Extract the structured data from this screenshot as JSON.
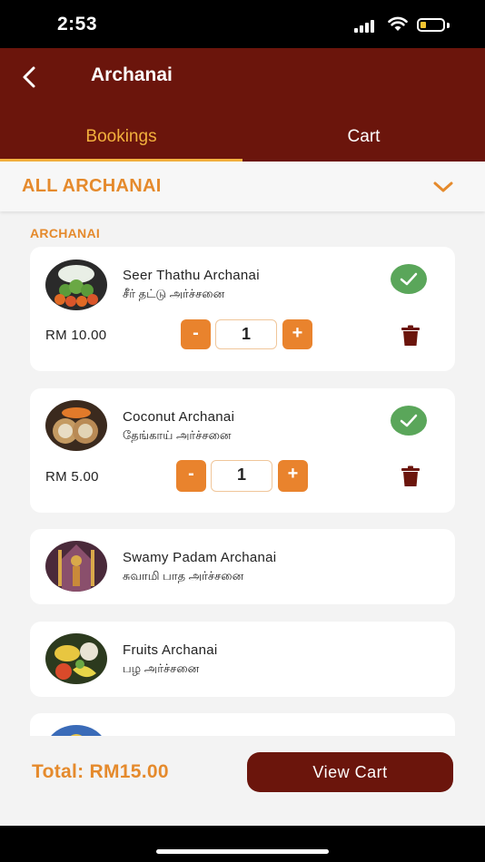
{
  "status_bar": {
    "time": "2:53"
  },
  "header": {
    "title": "Archanai"
  },
  "tabs": [
    {
      "label": "Bookings",
      "active": true
    },
    {
      "label": "Cart",
      "active": false
    }
  ],
  "filter": {
    "label": "ALL ARCHANAI"
  },
  "section_label": "ARCHANAI",
  "items": [
    {
      "name": "Seer Thathu Archanai",
      "tamil": "சீர் தட்டு அர்ச்சனை",
      "price": "RM 10.00",
      "quantity": "1",
      "selected": true
    },
    {
      "name": "Coconut Archanai",
      "tamil": "தேங்காய் அர்ச்சனை",
      "price": "RM 5.00",
      "quantity": "1",
      "selected": true
    },
    {
      "name": "Swamy Padam Archanai",
      "tamil": "சுவாமி பாத அர்ச்சனை",
      "selected": false
    },
    {
      "name": "Fruits Archanai",
      "tamil": "பழ அர்ச்சனை",
      "selected": false
    }
  ],
  "qty_controls": {
    "minus": "-",
    "plus": "+"
  },
  "footer": {
    "total": "Total: RM15.00",
    "view_cart_label": "View Cart"
  },
  "colors": {
    "brand": "#6b150c",
    "accent": "#e58a2c",
    "check": "#5aa65a"
  }
}
